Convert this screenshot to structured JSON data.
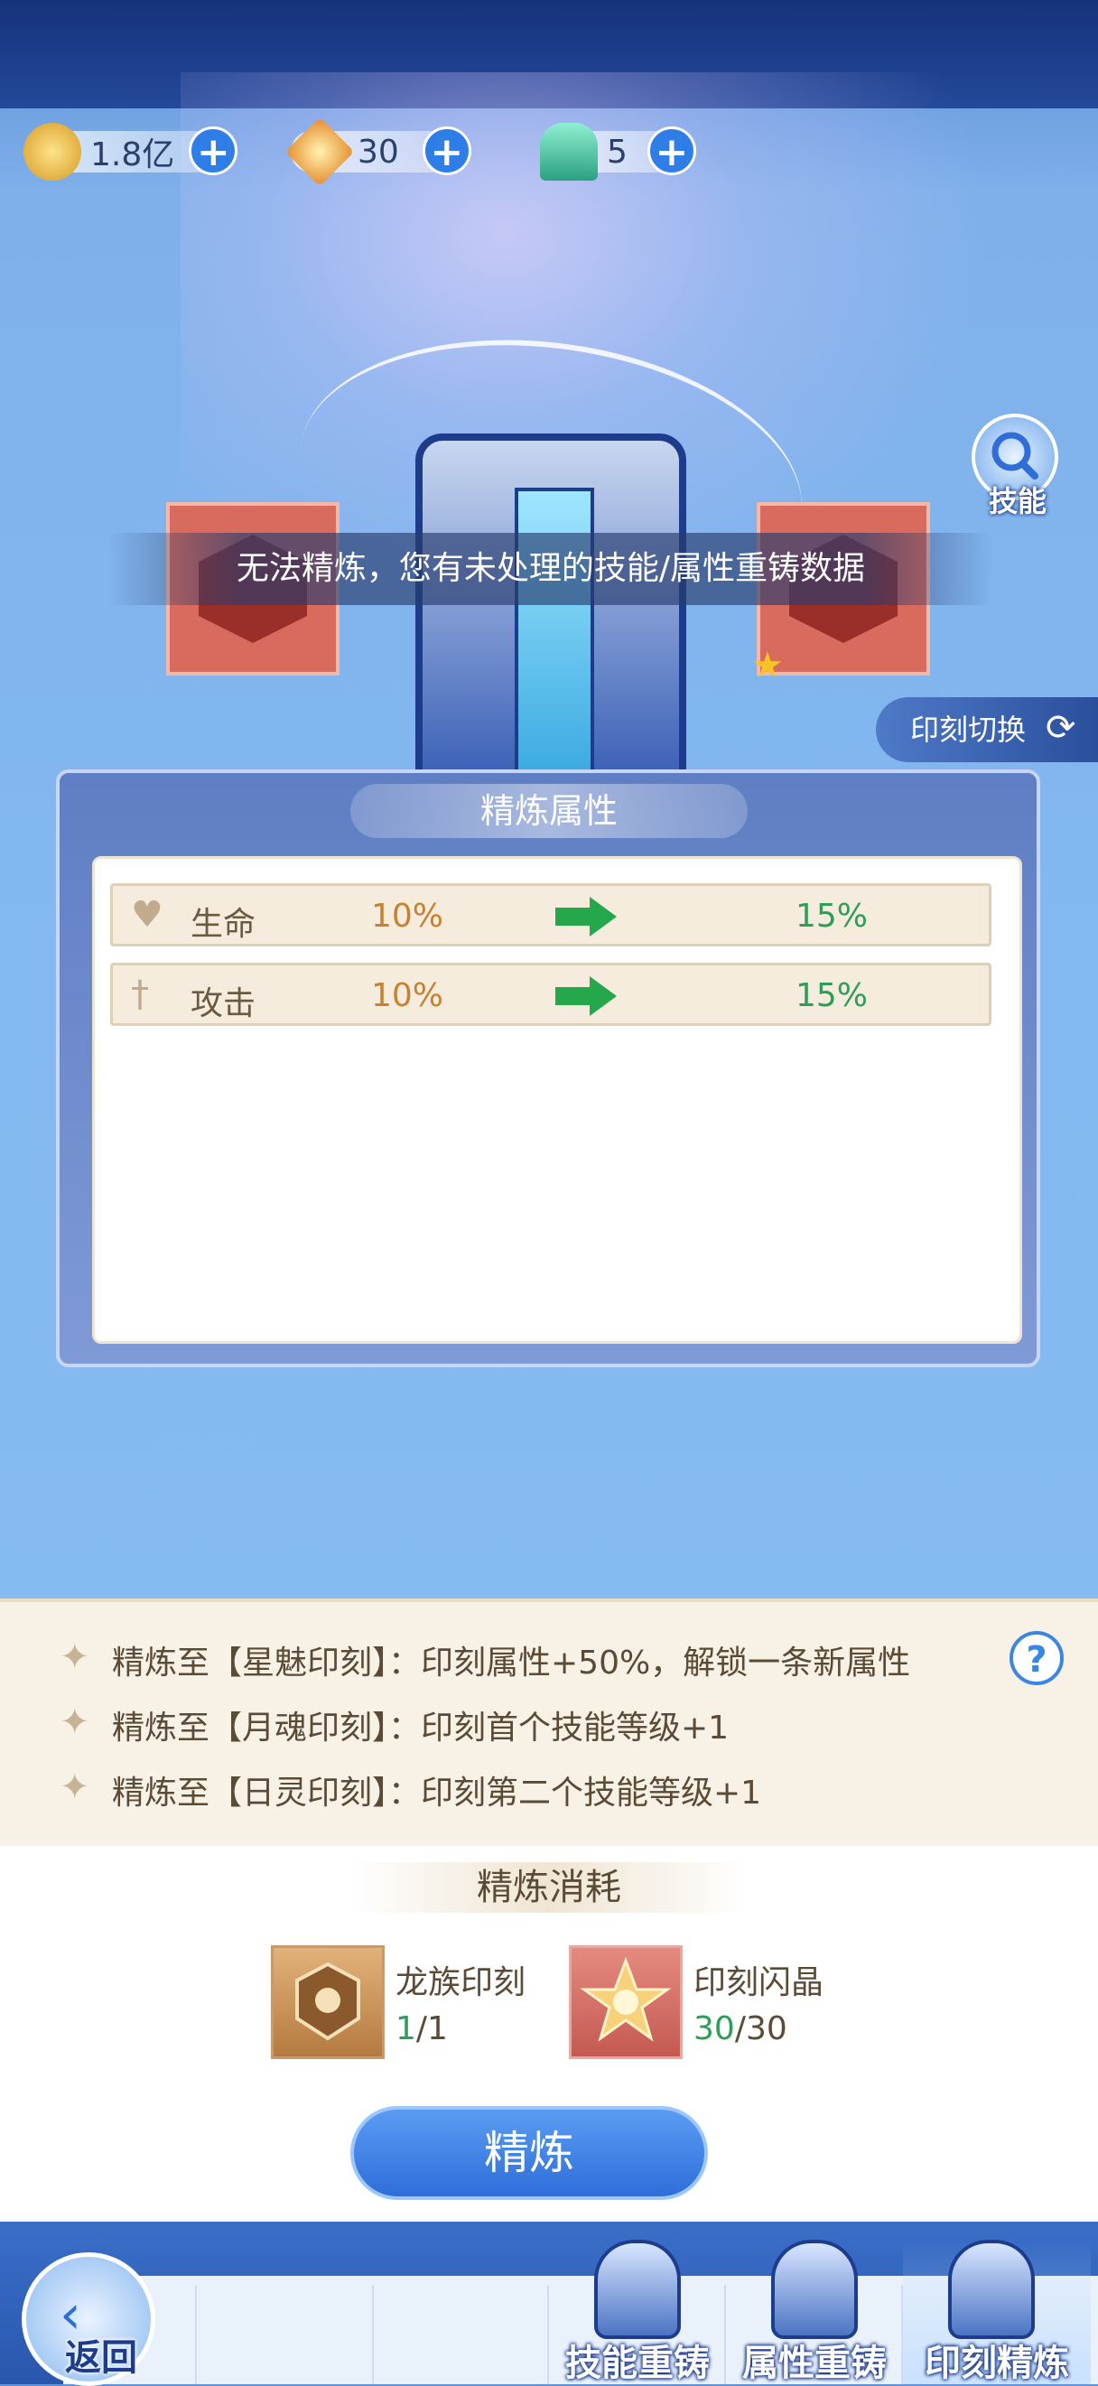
{
  "resources": [
    {
      "name": "gold-coin",
      "value": "1.8亿",
      "icon": "coin-icon",
      "color": "#f0c24b"
    },
    {
      "name": "star-gem",
      "value": "30",
      "icon": "sun-gem-icon",
      "color": "#f1a23a"
    },
    {
      "name": "crystal",
      "value": "5",
      "icon": "crystal-icon",
      "color": "#37c2a0"
    }
  ],
  "skill_button_label": "技能",
  "warning": "无法精炼，您有未处理的技能/属性重铸数据",
  "switch_label": "印刻切换",
  "panel": {
    "title": "精炼属性",
    "attributes": [
      {
        "name": "生命",
        "from": "10%",
        "to": "15%",
        "icon": "heart-icon"
      },
      {
        "name": "攻击",
        "from": "10%",
        "to": "15%",
        "icon": "sword-icon"
      }
    ]
  },
  "rules": [
    "精炼至【星魅印刻】：印刻属性+50%，解锁一条新属性",
    "精炼至【月魂印刻】：印刻首个技能等级+1",
    "精炼至【日灵印刻】：印刻第二个技能等级+1"
  ],
  "cost": {
    "title": "精炼消耗",
    "items": [
      {
        "name": "龙族印刻",
        "have": "1",
        "need": "1"
      },
      {
        "name": "印刻闪晶",
        "have": "30",
        "need": "30"
      }
    ]
  },
  "refine_button": "精炼",
  "nav": {
    "back": "返回",
    "tabs": [
      "技能重铸",
      "属性重铸",
      "印刻精炼"
    ],
    "active_tab": "印刻精炼"
  }
}
